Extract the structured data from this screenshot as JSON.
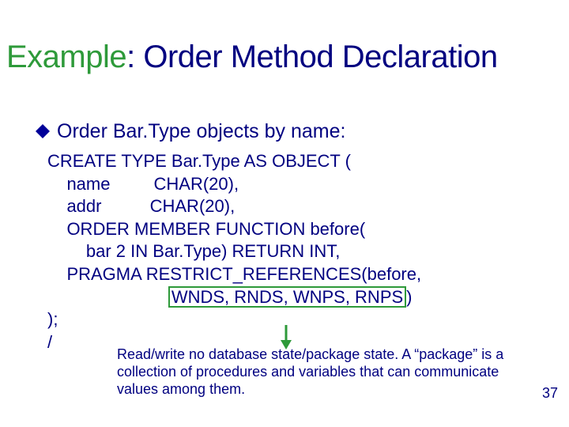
{
  "title": {
    "example_word": "Example",
    "rest": ": Order Method Declaration"
  },
  "bullet": {
    "text": "Order Bar.Type objects by name:"
  },
  "code": {
    "l1": "CREATE TYPE Bar.Type AS OBJECT (",
    "l2": "    name         CHAR(20),",
    "l3": "    addr          CHAR(20),",
    "l4": "    ORDER MEMBER FUNCTION before(",
    "l5": "        bar 2 IN Bar.Type) RETURN INT,",
    "l6": "    PRAGMA RESTRICT_REFERENCES(before,",
    "l7_indent": "                         ",
    "l7_hl": "WNDS, RNDS, WNPS, RNPS",
    "l7_close": ")",
    "l8": ");",
    "l9": "/"
  },
  "note": "Read/write no database state/package state. A “package” is a collection of procedures and variables that can communicate values among them.",
  "page": "37"
}
